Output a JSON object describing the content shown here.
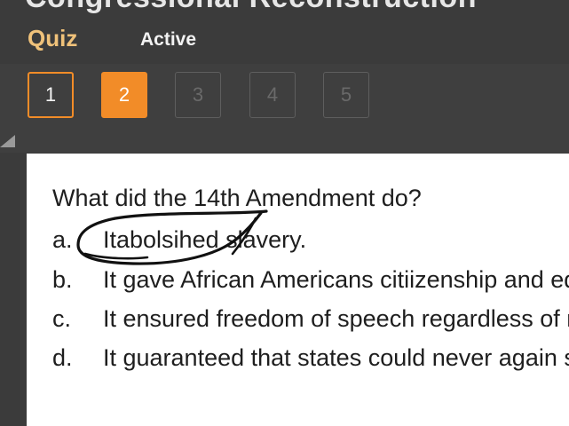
{
  "header": {
    "course_title": "Congressional Reconstruction",
    "quiz_label": "Quiz",
    "status_label": "Active"
  },
  "question_nav": [
    {
      "label": "1",
      "state": "done"
    },
    {
      "label": "2",
      "state": "current"
    },
    {
      "label": "3",
      "state": "locked"
    },
    {
      "label": "4",
      "state": "locked"
    },
    {
      "label": "5",
      "state": "locked"
    }
  ],
  "question": {
    "text": "What did the 14th Amendment do?",
    "answers": [
      {
        "letter": "a.",
        "text": "Itabolsihed slavery."
      },
      {
        "letter": "b.",
        "text": "It gave African Americans citiizenship and equal protection"
      },
      {
        "letter": "c.",
        "text": "It ensured freedom of speech regardless of race"
      },
      {
        "letter": "d.",
        "text": "It guaranteed that states could never again secede"
      }
    ]
  },
  "colors": {
    "accent": "#f28c28",
    "quiz_label": "#f0c27a",
    "background": "#3b3b3b",
    "content_bg": "#ffffff",
    "ink": "#111111"
  }
}
